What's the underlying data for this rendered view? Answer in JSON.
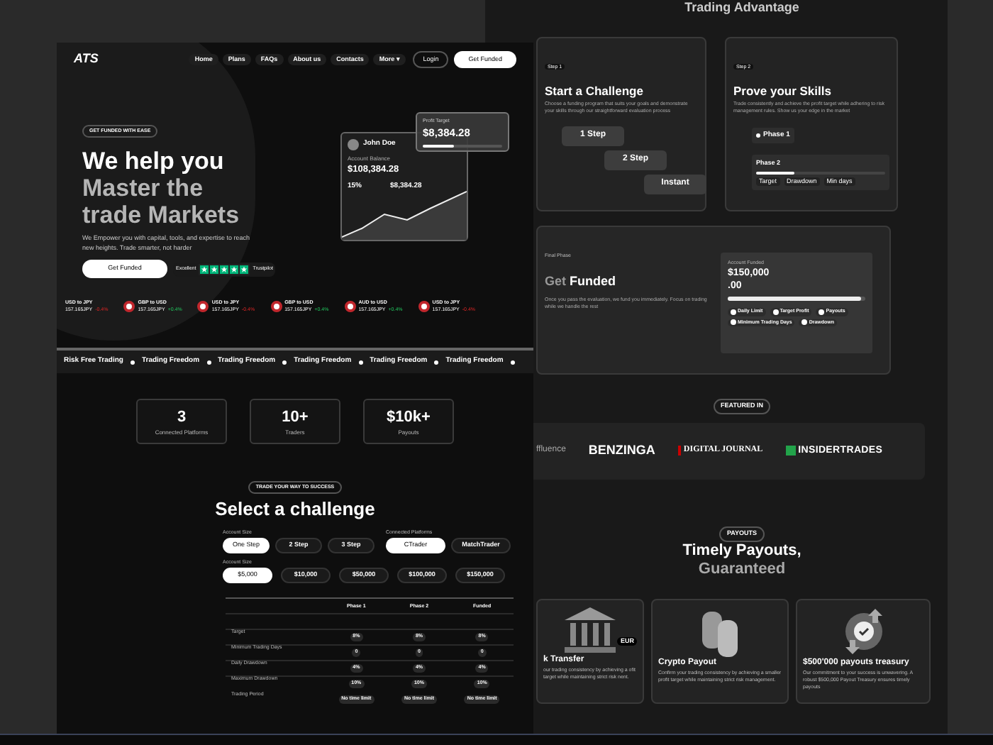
{
  "left_page": {
    "nav": {
      "logo": "ATS",
      "links": [
        "Home",
        "Plans",
        "FAQs",
        "About us",
        "Contacts",
        "More ▾"
      ],
      "login": "Login",
      "cta": "Get Funded"
    },
    "hero": {
      "badge": "GET FUNDED WITH EASE",
      "title_lines": [
        "We help you",
        "Master the",
        "trade Markets"
      ],
      "subtitle": "We Empower you with capital, tools, and expertise to reach new heights. Trade smarter, not harder",
      "button": "Get Funded",
      "rating": {
        "label": "Excellent",
        "stars": 5,
        "source": "Trustpilot"
      }
    },
    "account_card": {
      "name": "John Doe",
      "balance_label": "Account Balance",
      "balance": "$108,384.28",
      "stats": [
        "15%",
        "$8,384.28"
      ]
    },
    "profit_card": {
      "label": "Profit Target",
      "value": "$8,384.28",
      "level": 0.4
    },
    "ticker": [
      {
        "pair": "USD to JPY",
        "price": "157.165JPY",
        "change": "-0.4%",
        "kind": "down"
      },
      {
        "pair": "GBP to USD",
        "price": "157.165JPY",
        "change": "+0.4%",
        "kind": "up"
      },
      {
        "pair": "USD to JPY",
        "price": "157.165JPY",
        "change": "-0.4%",
        "kind": "down"
      },
      {
        "pair": "GBP to USD",
        "price": "157.165JPY",
        "change": "+0.4%",
        "kind": "up"
      },
      {
        "pair": "AUD to USD",
        "price": "157.165JPY",
        "change": "+0.4%",
        "kind": "up"
      },
      {
        "pair": "USD to JPY",
        "price": "157.165JPY",
        "change": "-0.4%",
        "kind": "down"
      }
    ],
    "marquee": [
      "Risk Free Trading",
      "Trading Freedom",
      "Trading Freedom",
      "Trading Freedom",
      "Trading Freedom",
      "Trading Freedom"
    ],
    "stats": [
      {
        "value": "3",
        "label": "Connected Platforms"
      },
      {
        "value": "10+",
        "label": "Traders"
      },
      {
        "value": "$10k+",
        "label": "Payouts"
      }
    ],
    "challenge": {
      "badge": "TRADE YOUR WAY TO SUCCESS",
      "title": "Select a challenge",
      "steps_label": "Account Size",
      "steps": [
        {
          "label": "One Step",
          "selected": true
        },
        {
          "label": "2 Step",
          "selected": false
        },
        {
          "label": "3 Step",
          "selected": false
        }
      ],
      "platforms_label": "Connected Platforms",
      "platforms": [
        {
          "label": "CTrader",
          "selected": true
        },
        {
          "label": "MatchTrader",
          "selected": false
        }
      ],
      "sizes_label": "Account Size",
      "sizes": [
        {
          "label": "$5,000",
          "selected": true
        },
        {
          "label": "$10,000",
          "selected": false
        },
        {
          "label": "$50,000",
          "selected": false
        },
        {
          "label": "$100,000",
          "selected": false
        },
        {
          "label": "$150,000",
          "selected": false
        }
      ],
      "table": {
        "columns": [
          "Phase 1",
          "Phase 2",
          "Funded"
        ],
        "rows": [
          {
            "label": "Target",
            "values": [
              "8%",
              "8%",
              "8%"
            ]
          },
          {
            "label": "Minimum Trading Days",
            "values": [
              "0",
              "0",
              "0"
            ]
          },
          {
            "label": "Daily Drawdown",
            "values": [
              "4%",
              "4%",
              "4%"
            ]
          },
          {
            "label": "Maximum Drawdown",
            "values": [
              "10%",
              "10%",
              "10%"
            ]
          },
          {
            "label": "Trading Period",
            "values": [
              "No time limit",
              "No time limit",
              "No time limit"
            ]
          }
        ]
      }
    }
  },
  "right_page": {
    "heading": "Trading Advantage",
    "step1": {
      "tag": "Step 1",
      "title": "Start a Challenge",
      "text": "Choose a funding program that suits your goals and demonstrate your skills through our straightforward evaluation process",
      "pills": [
        "1 Step",
        "2 Step",
        "Instant"
      ]
    },
    "step2": {
      "tag": "Step 2",
      "title": "Prove your Skills",
      "text": "Trade consistently and achieve the profit target while adhering to risk management rules. Show us your edge in the market",
      "phase1": "Phase 1",
      "phase2": "Phase 2",
      "level": 0.3,
      "chips": [
        "Target",
        "Drawdown",
        "Min days"
      ]
    },
    "final": {
      "tag": "Final Phase",
      "title_muted": "Get",
      "title": "Funded",
      "text": "Once you pass the evaluation, we fund you immediately. Focus on trading while we handle the rest",
      "account_label": "Account Funded",
      "amount_lines": [
        "$150,000",
        ".00"
      ],
      "level": 0.97,
      "checks": [
        {
          "label": "Daily Limit",
          "checked": true
        },
        {
          "label": "Target Profit",
          "checked": true
        },
        {
          "label": "Payouts",
          "checked": true
        },
        {
          "label": "Minimum Trading Days",
          "checked": true
        },
        {
          "label": "Drawdown",
          "checked": true
        }
      ]
    },
    "featured": {
      "badge": "FEATURED IN",
      "logos": [
        {
          "kind": "plain",
          "text": "ffluence"
        },
        {
          "kind": "bold",
          "text": "BENZINGA"
        },
        {
          "kind": "serif",
          "text": "DIGITAL JOURNAL"
        },
        {
          "kind": "boxed",
          "text": "INSIDERTRADES"
        }
      ]
    },
    "payouts": {
      "badge": "PAYOUTS",
      "title_lines": [
        "Timely Payouts,",
        "Guaranteed"
      ],
      "cards": [
        {
          "kind": "bank",
          "title": "k Transfer",
          "tag": "EUR",
          "text": "our trading consistency by achieving a ofit target while maintaining strict risk nent."
        },
        {
          "kind": "crypto",
          "title": "Crypto Payout",
          "text": "Confirm your trading consistency by achieving a smaller profit target while maintaining strict risk management."
        },
        {
          "kind": "treasury",
          "title": "$500'000 payouts treasury",
          "text": "Our commitment to your success is unwavering. A robust $500,000 Payout Treasury ensures timely payouts"
        }
      ]
    }
  }
}
